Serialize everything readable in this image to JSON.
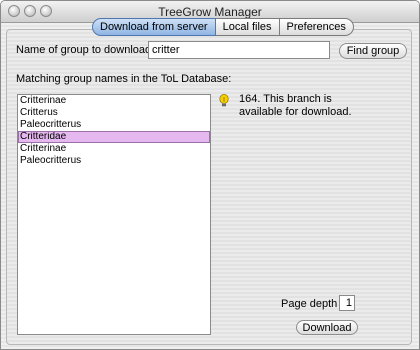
{
  "window": {
    "title": "TreeGrow Manager"
  },
  "tabs": [
    {
      "label": "Download from server",
      "active": true
    },
    {
      "label": "Local files",
      "active": false
    },
    {
      "label": "Preferences",
      "active": false
    }
  ],
  "search": {
    "label": "Name of group to download",
    "value": "critter",
    "button_label": "Find group"
  },
  "results": {
    "label": "Matching group names in the ToL Database:",
    "items": [
      "Critterinae",
      "Critterus",
      "Paleocritterus",
      "Critteridae",
      "Critterinae",
      "Paleocritterus"
    ],
    "selected_index": 3
  },
  "info": {
    "icon": "lightbulb-icon",
    "text": "164. This branch is available for download."
  },
  "download": {
    "page_depth_label": "Page depth",
    "page_depth_value": "1",
    "button_label": "Download"
  },
  "colors": {
    "selection": "#e6b8f0",
    "active_tab": "#8fb4e3"
  }
}
